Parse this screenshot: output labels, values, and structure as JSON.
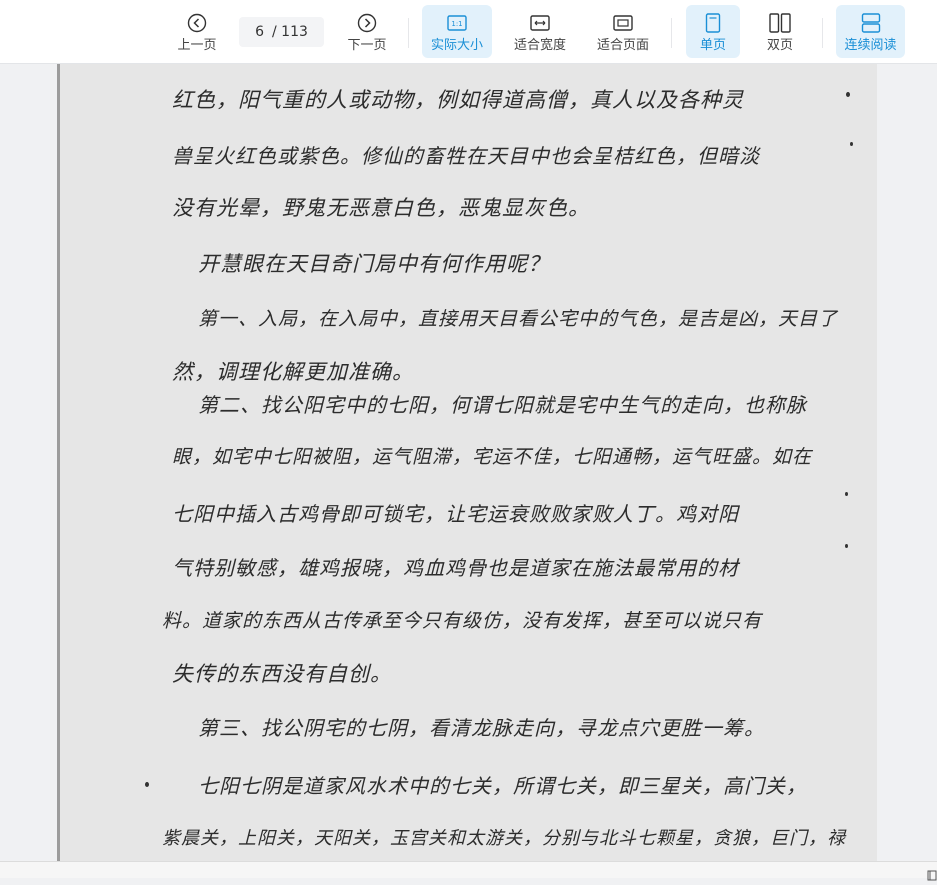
{
  "toolbar": {
    "prev_page": "上一页",
    "next_page": "下一页",
    "current_page": "6",
    "total_pages": "/ 113",
    "actual_size": "实际大小",
    "fit_width": "适合宽度",
    "fit_page": "适合页面",
    "single_page": "单页",
    "double_page": "双页",
    "continuous": "连续阅读",
    "accent_color": "#1a8fd6"
  },
  "document": {
    "lines": [
      "红色，阳气重的人或动物，例如得道高僧，真人以及各种灵",
      "兽呈火红色或紫色。修仙的畜牲在天目中也会呈桔红色，但暗淡",
      "没有光晕，野鬼无恶意白色，恶鬼显灰色。",
      "开慧眼在天目奇门局中有何作用呢？",
      "第一、入局，在入局中，直接用天目看公宅中的气色，是吉是凶，天目了",
      "然，调理化解更加准确。",
      "第二、找公阳宅中的七阳，何谓七阳就是宅中生气的走向，也称脉",
      "眼，如宅中七阳被阻，运气阻滞，宅运不佳，七阳通畅，运气旺盛。如在",
      "七阳中插入古鸡骨即可锁宅，让宅运衰败败家败人丁。鸡对阳",
      "气特别敏感，雄鸡报晓，鸡血鸡骨也是道家在施法最常用的材",
      "料。道家的东西从古传承至今只有级仿，没有发挥，甚至可以说只有",
      "失传的东西没有自创。",
      "第三、找公阴宅的七阴，看清龙脉走向，寻龙点穴更胜一筹。",
      "七阳七阴是道家风水术中的七关，所谓七关，即三星关，高门关，",
      "紫晨关，上阳关，天阳关，玉宫关和太游关，分别与北斗七颗星，贪狼，巨门，禄"
    ]
  }
}
